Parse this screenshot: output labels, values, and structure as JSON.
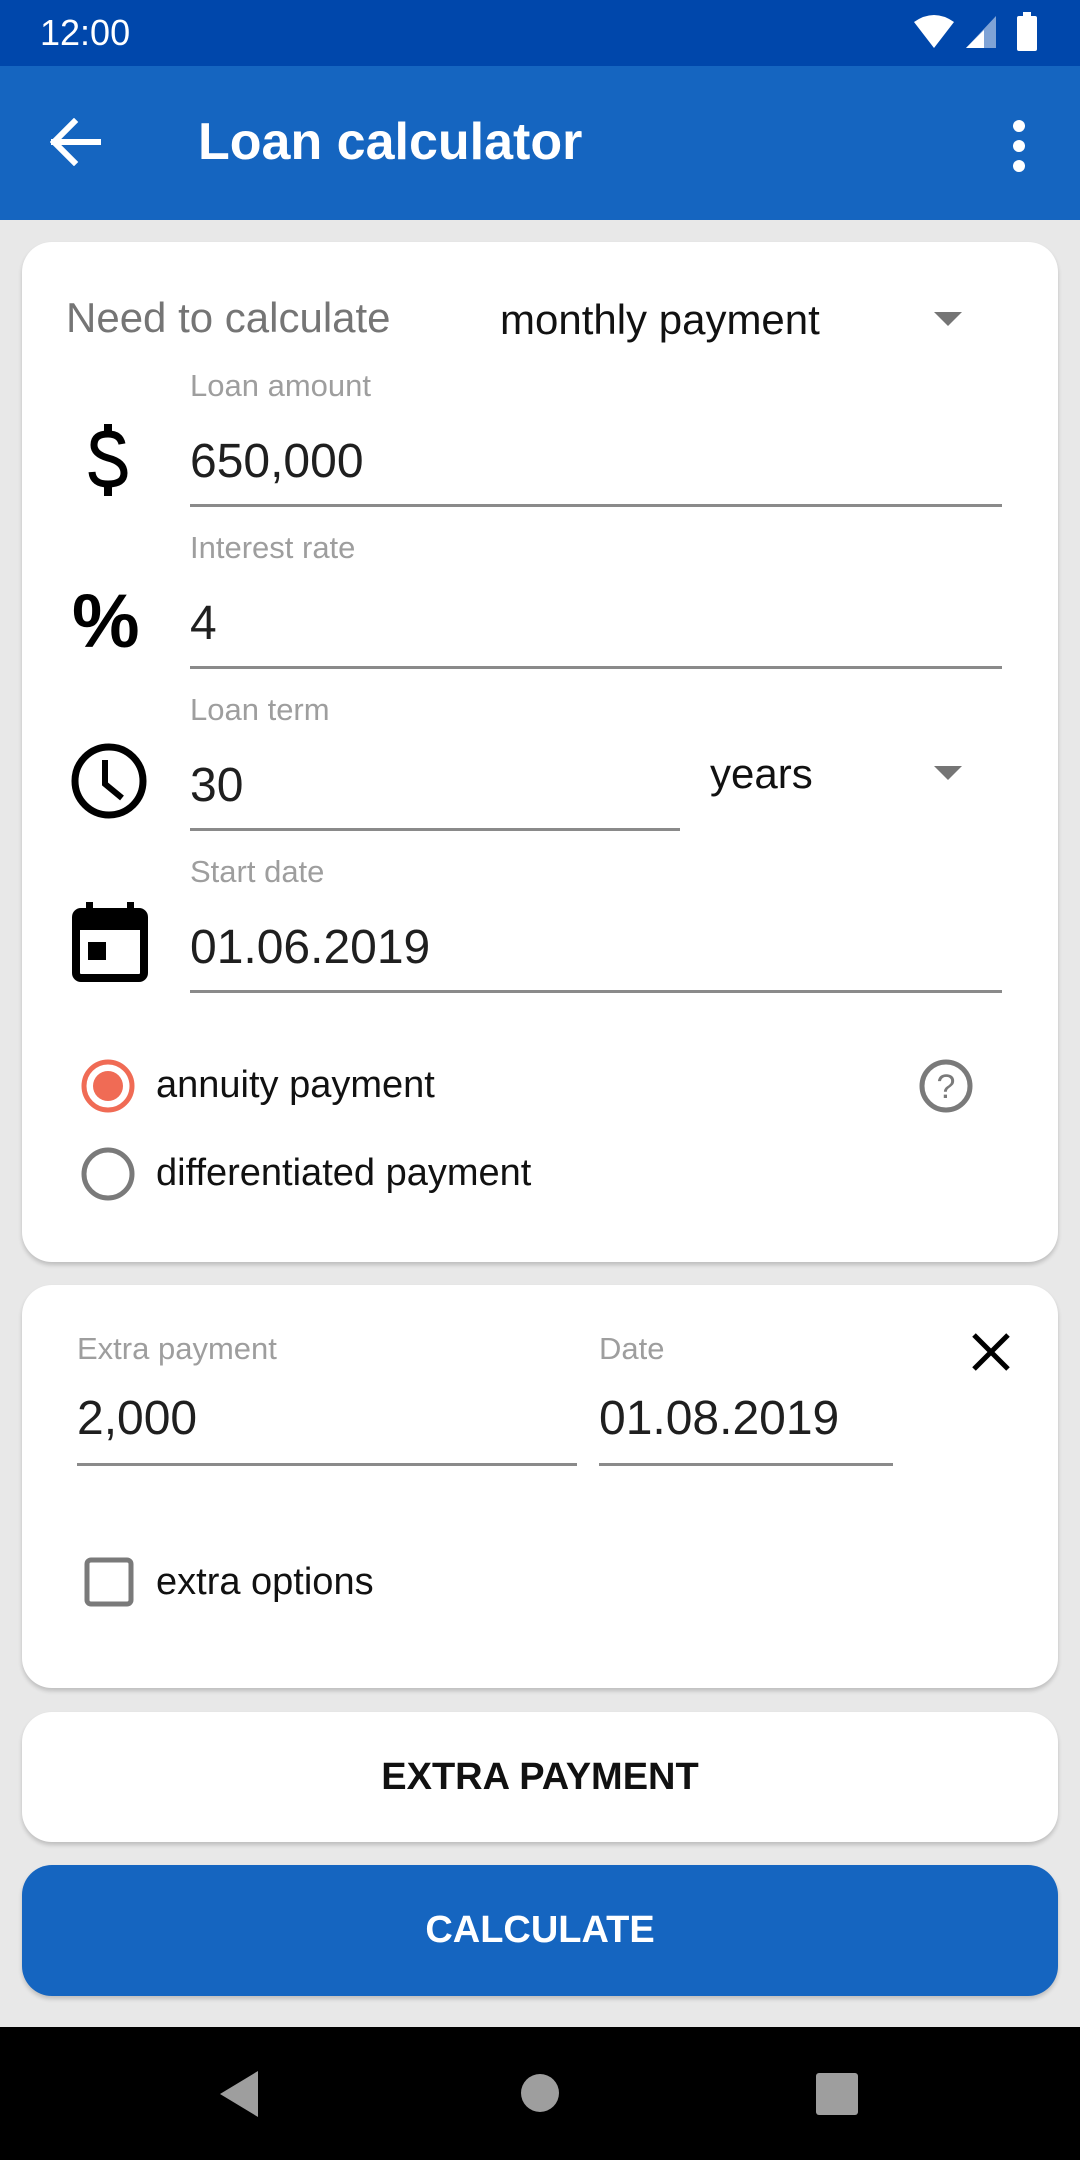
{
  "status_bar": {
    "time": "12:00"
  },
  "app_bar": {
    "title": "Loan calculator",
    "back_icon": "arrow-left-icon",
    "menu_icon": "more-vert-icon"
  },
  "form": {
    "need_to_calculate": {
      "label": "Need to calculate",
      "selected": "monthly payment"
    },
    "loan_amount": {
      "label": "Loan amount",
      "value": "650,000",
      "icon": "dollar-icon"
    },
    "interest_rate": {
      "label": "Interest rate",
      "value": "4",
      "icon": "percent-icon"
    },
    "loan_term": {
      "label": "Loan term",
      "value": "30",
      "unit": "years",
      "icon": "clock-icon"
    },
    "start_date": {
      "label": "Start date",
      "value": "01.06.2019",
      "icon": "calendar-icon"
    },
    "payment_type": {
      "options": [
        {
          "label": "annuity payment",
          "selected": true
        },
        {
          "label": "differentiated payment",
          "selected": false
        }
      ],
      "help_icon": "help-circle-icon"
    }
  },
  "extra": {
    "amount_label": "Extra payment",
    "amount_value": "2,000",
    "date_label": "Date",
    "date_value": "01.08.2019",
    "extra_options_label": "extra options",
    "extra_options_checked": false
  },
  "buttons": {
    "extra_payment": "EXTRA PAYMENT",
    "calculate": "CALCULATE"
  },
  "colors": {
    "status_bar": "#0047ab",
    "app_bar": "#1565c0",
    "accent_radio": "#f06b55",
    "calculate_button": "#1565c0"
  }
}
